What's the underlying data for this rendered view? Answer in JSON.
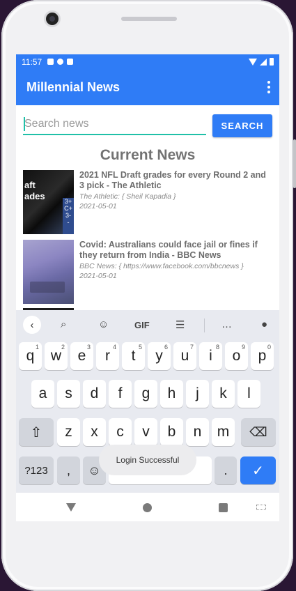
{
  "status_bar": {
    "time": "11:57"
  },
  "app_bar": {
    "title": "Millennial News",
    "overflow_icon": "more-vert-icon"
  },
  "search": {
    "placeholder": "Search news",
    "value": "",
    "button_label": "SEARCH"
  },
  "section_title": "Current News",
  "news": [
    {
      "title": "2021 NFL Draft grades for every Round 2 and 3 pick - The Athletic",
      "source": "The Athletic: { Sheil Kapadia }",
      "date": "2021-05-01",
      "thumb_text": "aft\nades",
      "thumb_side_text": "3+\nC+\n3-\n-"
    },
    {
      "title": "Covid: Australians could face jail or fines if they return from India - BBC News",
      "source": "BBC News: { https://www.facebook.com/bbcnews }",
      "date": "2021-05-01"
    }
  ],
  "keyboard": {
    "toolbar_icons": [
      "back-icon",
      "search-icon",
      "sticker-icon",
      "gif-icon",
      "clipboard-icon",
      "more-icon",
      "mic-icon"
    ],
    "gif_label": "GIF",
    "row1": [
      {
        "key": "q",
        "hint": "1"
      },
      {
        "key": "w",
        "hint": "2"
      },
      {
        "key": "e",
        "hint": "3"
      },
      {
        "key": "r",
        "hint": "4"
      },
      {
        "key": "t",
        "hint": "5"
      },
      {
        "key": "y",
        "hint": "6"
      },
      {
        "key": "u",
        "hint": "7"
      },
      {
        "key": "i",
        "hint": "8"
      },
      {
        "key": "o",
        "hint": "9"
      },
      {
        "key": "p",
        "hint": "0"
      }
    ],
    "row2": [
      "a",
      "s",
      "d",
      "f",
      "g",
      "h",
      "j",
      "k",
      "l"
    ],
    "row3": [
      "z",
      "x",
      "c",
      "v",
      "b",
      "n",
      "m"
    ],
    "symbols_label": "?123",
    "comma_label": ",",
    "period_label": "."
  },
  "toast": "Login Successful",
  "colors": {
    "primary": "#2f7cf6",
    "accent": "#20c0a8"
  }
}
